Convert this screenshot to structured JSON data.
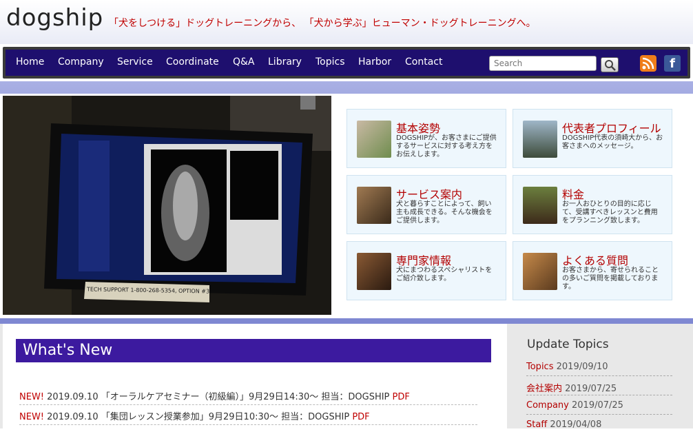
{
  "header": {
    "logo_text": "dogship",
    "tagline": "「犬をしつける」ドッグトレーニングから、 「犬から学ぶ」ヒューマン・ドッグトレーニングへ。"
  },
  "nav": {
    "items": [
      "Home",
      "Company",
      "Service",
      "Coordinate",
      "Q&A",
      "Library",
      "Topics",
      "Harbor",
      "Contact"
    ],
    "search_placeholder": "Search",
    "search_button_icon": "magnifier-icon",
    "social_icons": [
      "rss-icon",
      "facebook-icon"
    ],
    "facebook_letter": "f"
  },
  "hero": {
    "photo_alt_icon": "x-ray-monitor-photo",
    "monitor_caption": "TECH SUPPORT 1-800-268-5354, OPTION #3"
  },
  "cards": [
    {
      "title": "基本姿勢",
      "desc": "DOGSHIPが、お客さまにご提供するサービスに対する考え方をお伝えします。"
    },
    {
      "title": "代表者プロフィール",
      "desc": "DOGSHIP代表の須崎大から、お客さまへのメッセージ。"
    },
    {
      "title": "サービス案内",
      "desc": "犬と暮らすことによって、飼い主も成長できる。そんな機会をご提供します。"
    },
    {
      "title": "料金",
      "desc": "お一人おひとりの目的に応じて、受講すべきレッスンと費用をプランニング致します。"
    },
    {
      "title": "専門家情報",
      "desc": "犬にまつわるスペシャリストをご紹介致します。"
    },
    {
      "title": "よくある質問",
      "desc": "お客さまから、寄せられることの多いご質問を掲載しております。"
    }
  ],
  "news": {
    "heading": "What's New",
    "items": [
      {
        "badge": "NEW!",
        "date": "2019.09.10",
        "text": "「オーラルケアセミナー（初級編）」9月29日14:30～ 担当：DOGSHIP",
        "link": "PDF"
      },
      {
        "badge": "NEW!",
        "date": "2019.09.10",
        "text": "「集団レッスン授業参加」9月29日10:30～ 担当：DOGSHIP",
        "link": "PDF"
      }
    ]
  },
  "sidebar": {
    "title": "Update Topics",
    "items": [
      {
        "label": "Topics",
        "date": "2019/09/10"
      },
      {
        "label": "会社案内",
        "date": "2019/07/25"
      },
      {
        "label": "Company",
        "date": "2019/07/25"
      },
      {
        "label": "Staff",
        "date": "2019/04/08"
      }
    ]
  },
  "colors": {
    "nav_bg": "#1e0f6e",
    "accent_red": "#c00000",
    "news_heading_bg": "#3c1a9f",
    "hero_band": "#7f88d2"
  }
}
